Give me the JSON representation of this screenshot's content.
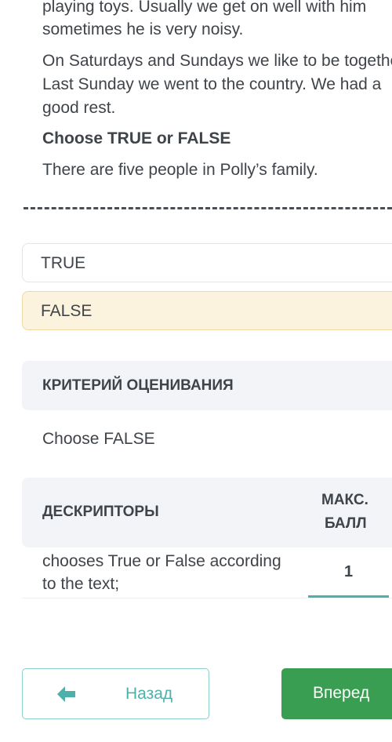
{
  "passage": {
    "line1_partial": "playing toys. Usually we get on well with him",
    "line2": "sometimes he is very noisy.",
    "para2_line1": "On Saturdays and Sundays we like to be together.",
    "para2_line2": "Last Sunday we went to the country. We had a",
    "para2_line3": "good rest."
  },
  "question": {
    "instruction": "Choose TRUE or FALSE",
    "statement": "There are five people in Polly’s family."
  },
  "options": [
    {
      "label": "TRUE",
      "selected": false
    },
    {
      "label": "FALSE",
      "selected": true
    }
  ],
  "criteria": {
    "header": "КРИТЕРИЙ ОЦЕНИВАНИЯ",
    "value": "Choose FALSE"
  },
  "descriptors": {
    "header": "ДЕСКРИПТОРЫ",
    "max_header_line1": "МАКС.",
    "max_header_line2": "БАЛЛ",
    "rows": [
      {
        "line1": "chooses True or False according",
        "line2": "to the text;",
        "score": "1"
      }
    ]
  },
  "nav": {
    "back_label": "Назад",
    "back_icon": "arrow-left-icon",
    "next_label": "Вперед"
  },
  "colors": {
    "accent_teal": "#4fb0aa",
    "next_green": "#3a9e52",
    "selected_bg": "#fcf3df"
  }
}
